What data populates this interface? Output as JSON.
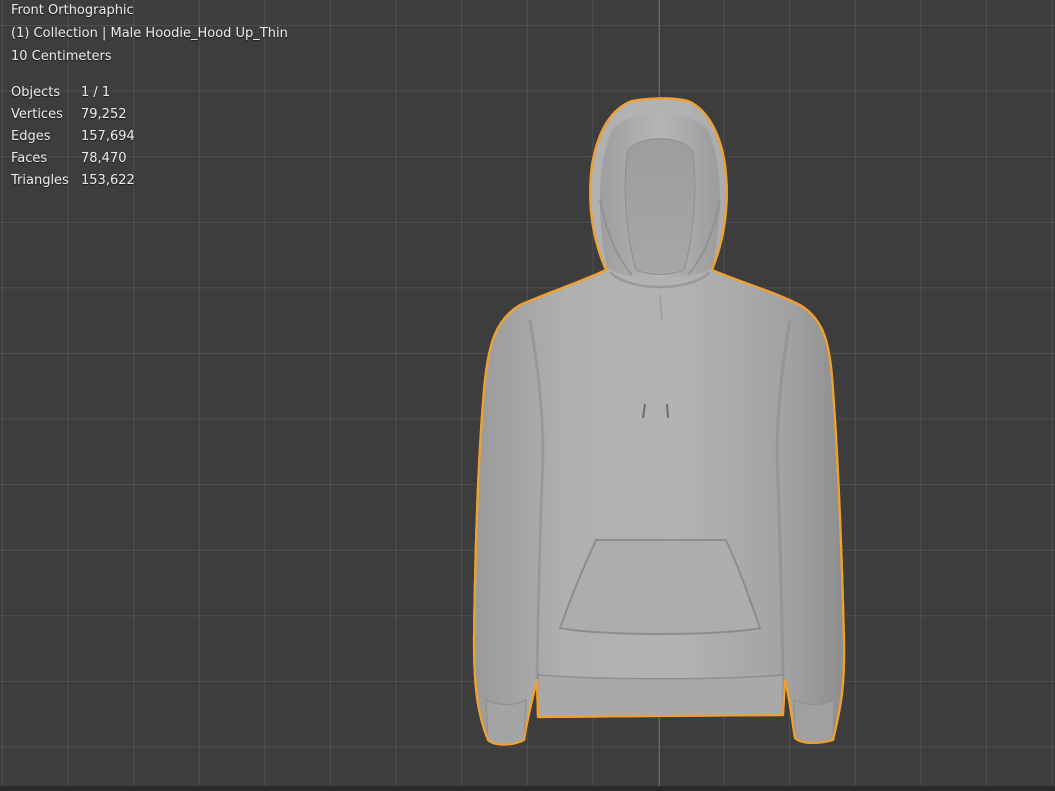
{
  "viewport": {
    "view_name": "Front Orthographic",
    "collection_label": "(1) Collection | Male Hoodie_Hood Up_Thin",
    "grid_scale": "10 Centimeters",
    "stats": [
      {
        "label": "Objects",
        "value": "1 / 1"
      },
      {
        "label": "Vertices",
        "value": "79,252"
      },
      {
        "label": "Edges",
        "value": "157,694"
      },
      {
        "label": "Faces",
        "value": "78,470"
      },
      {
        "label": "Triangles",
        "value": "153,622"
      }
    ]
  },
  "colors": {
    "background": "#3d3d3d",
    "grid_line": "#4a4a4a",
    "z_axis": "#3e67b8",
    "selection_outline": "#f0a030",
    "mesh": "#a9a9a9"
  }
}
